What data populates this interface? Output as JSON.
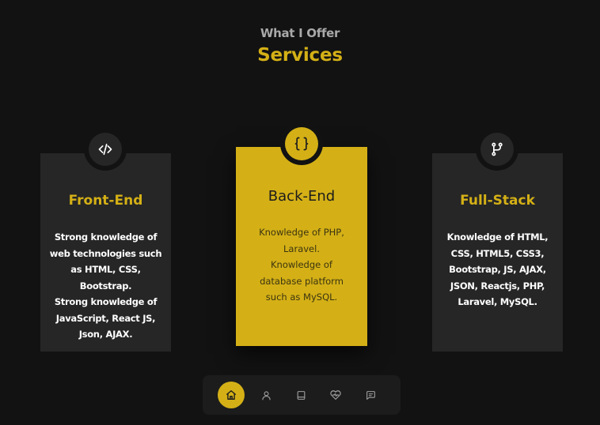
{
  "header": {
    "subtitle": "What I Offer",
    "title": "Services"
  },
  "services": [
    {
      "title": "Front-End",
      "icon": "code-icon",
      "lines": [
        "Strong knowledge of",
        "web technologies such",
        "as HTML, CSS,",
        "Bootstrap.",
        "Strong knowledge of",
        "JavaScript, React JS,",
        "Json, AJAX."
      ]
    },
    {
      "title": "Back-End",
      "icon": "braces-icon",
      "lines": [
        "Knowledge of PHP,",
        "Laravel.",
        "Knowledge of",
        "database platform",
        "such as MySQL."
      ]
    },
    {
      "title": "Full-Stack",
      "icon": "git-branch-icon",
      "lines": [
        "Knowledge of HTML,",
        "CSS, HTML5, CSS3,",
        "Bootstrap, JS, AJAX,",
        "JSON, Reactjs, PHP,",
        "Laravel, MySQL."
      ]
    }
  ],
  "nav": {
    "items": [
      "home-icon",
      "user-icon",
      "book-icon",
      "heart-icon",
      "message-icon"
    ],
    "active": "home-icon"
  },
  "colors": {
    "background": "#121212",
    "accent": "#d4b016",
    "card": "#262626",
    "nav": "#1c1c1c"
  }
}
